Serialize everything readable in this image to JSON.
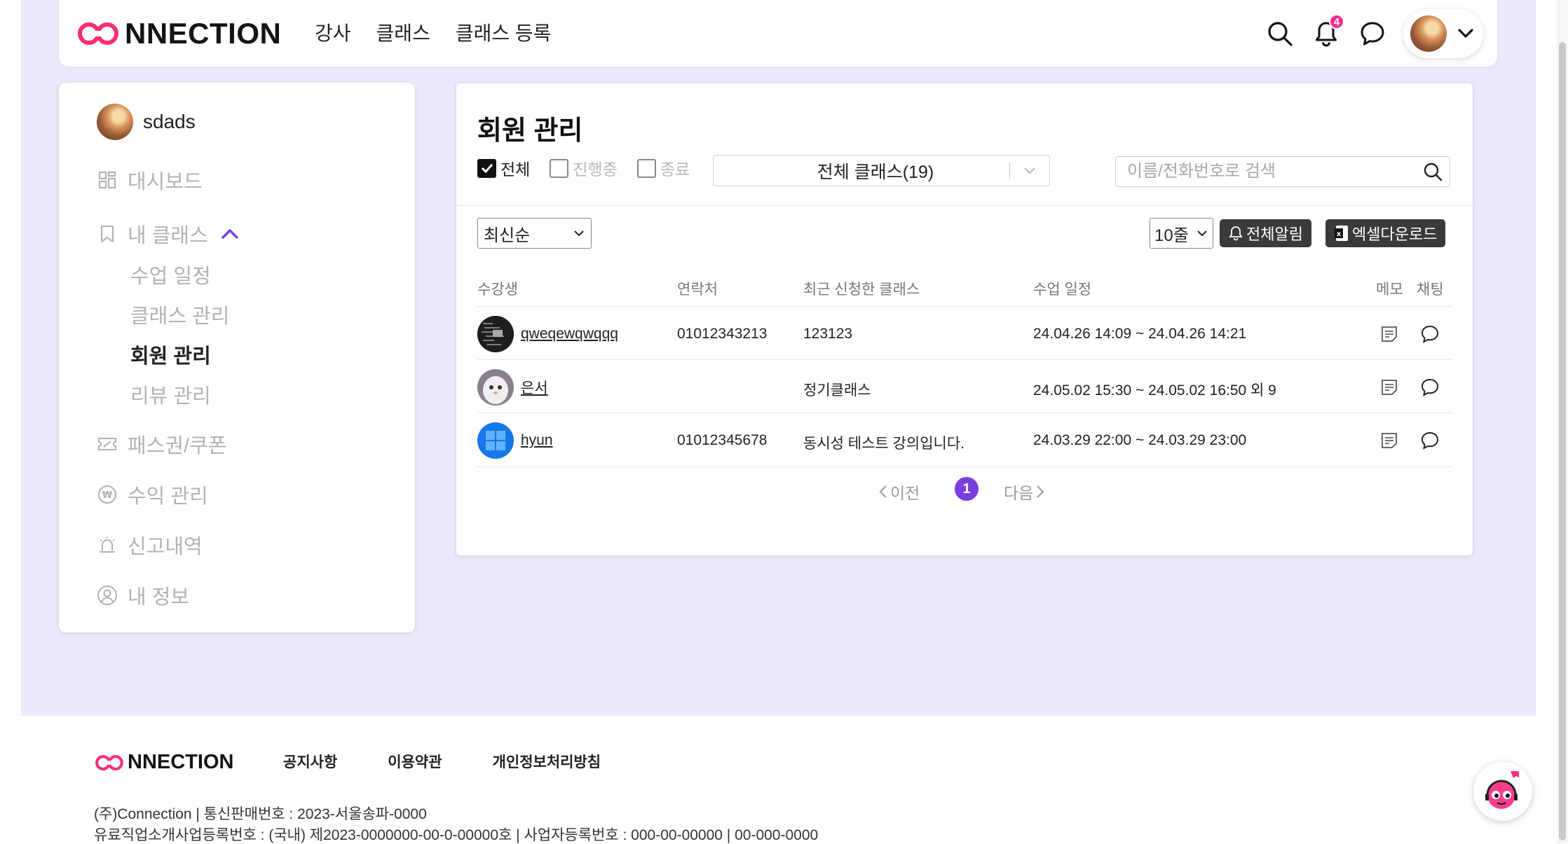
{
  "header": {
    "logo_text": "NNECTION",
    "nav": [
      "강사",
      "클래스",
      "클래스 등록"
    ],
    "notification_count": "4"
  },
  "sidebar": {
    "username": "sdads",
    "items": [
      {
        "label": "대시보드",
        "icon": "dashboard-icon"
      },
      {
        "label": "내 클래스",
        "icon": "bookmark-icon"
      },
      {
        "label": "패스권/쿠폰",
        "icon": "ticket-icon"
      },
      {
        "label": "수익 관리",
        "icon": "won-icon"
      },
      {
        "label": "신고내역",
        "icon": "siren-icon"
      },
      {
        "label": "내 정보",
        "icon": "user-icon"
      }
    ],
    "subitems": [
      "수업 일정",
      "클래스 관리",
      "회원 관리",
      "리뷰 관리"
    ],
    "active_subitem": "회원 관리"
  },
  "main": {
    "title": "회원 관리",
    "filters": [
      {
        "label": "전체",
        "checked": true
      },
      {
        "label": "진행중",
        "checked": false
      },
      {
        "label": "종료",
        "checked": false
      }
    ],
    "class_select": "전체 클래스(19)",
    "search_placeholder": "이름/전화번호로 검색",
    "sort": "최신순",
    "rows_per_page": "10줄",
    "notify_all_label": "전체알림",
    "excel_label": "엑셀다운로드",
    "columns": [
      "수강생",
      "연락처",
      "최근 신청한 클래스",
      "수업 일정",
      "메모",
      "채팅"
    ],
    "rows": [
      {
        "name": "qweqewqwqqq",
        "phone": "01012343213",
        "class": "123123",
        "schedule": "24.04.26 14:09 ~ 24.04.26 14:21"
      },
      {
        "name": "은서",
        "phone": "",
        "class": "정기클래스",
        "schedule": "24.05.02 15:30 ~ 24.05.02 16:50 외 9"
      },
      {
        "name": "hyun",
        "phone": "01012345678",
        "class": "동시성 테스트 강의입니다.",
        "schedule": "24.03.29 22:00 ~ 24.03.29 23:00"
      }
    ],
    "pagination": {
      "prev": "이전",
      "current": "1",
      "next": "다음"
    }
  },
  "footer": {
    "logo_text": "NNECTION",
    "links": [
      "공지사항",
      "이용약관",
      "개인정보처리방침"
    ],
    "info_line1": "(주)Connection | 통신판매번호 : 2023-서울송파-0000",
    "info_line2": "유료직업소개사업등록번호 : (국내) 제2023-0000000-00-0-00000호 | 사업자등록번호 : 000-00-00000 | 00-000-0000"
  },
  "colors": {
    "accent": "#7a3de0",
    "brand_pink": "#ff2d8a",
    "page_bg": "#ede9fb",
    "dark_button": "#3a3a3a"
  }
}
